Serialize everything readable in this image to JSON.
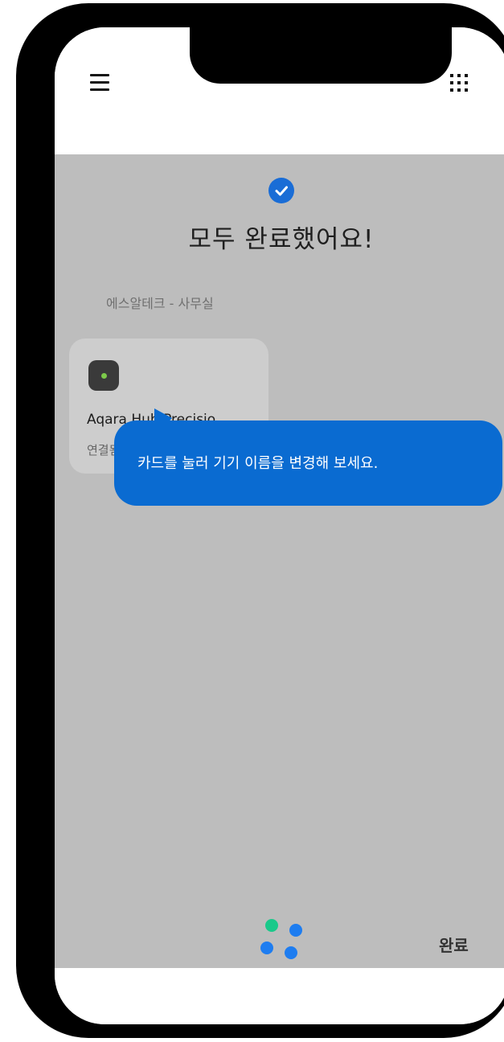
{
  "header": {
    "menu_icon": "hamburger-menu-icon",
    "apps_icon": "grid-apps-icon"
  },
  "main": {
    "check_icon": "check-circle-icon",
    "title": "모두 완료했어요!",
    "section_label": "에스알테크 - 사무실",
    "device_card": {
      "icon": "hub-device-icon",
      "name": "Aqara Hub Precisio",
      "status": "연결됨"
    },
    "tooltip": "카드를 눌러 기기 이름을 변경해 보세요.",
    "done_label": "완료",
    "logo_dot_colors": [
      "#19c98a",
      "#1e7df0",
      "#1e7df0",
      "#1e7df0"
    ]
  },
  "colors": {
    "accent": "#0a6bd1",
    "overlay": "#bdbdbd"
  }
}
